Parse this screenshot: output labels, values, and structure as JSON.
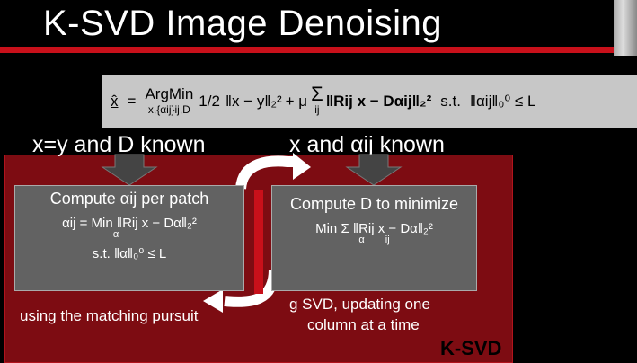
{
  "slide": {
    "title": "K-SVD Image Denoising",
    "formula": {
      "lhs": "x̂",
      "eq": "=",
      "argmin": "ArgMin",
      "argmin_sub": "x,{αij}ij,D",
      "half": "1/2",
      "term1": "‖x − y‖₂²",
      "plus_mu": "+ μ",
      "sum_sub": "ij",
      "term2": "‖Rij x − Dαij‖₂²",
      "st": "s.t.",
      "constraint": "‖αij‖₀⁰ ≤ L"
    },
    "left_known": "x=y and D known",
    "right_known": "x and αij known",
    "left_box": {
      "heading": "Compute αij per patch",
      "eq1": "αij = Min ‖Rij x − Dα‖₂²",
      "eq1_sub": "α",
      "eq2": "s.t. ‖α‖₀⁰ ≤ L"
    },
    "right_box": {
      "heading": "Compute D to minimize",
      "eq1": "Min Σ ‖Rij x − Dα‖₂²",
      "eq1_sub_min": "α",
      "eq1_sub_sum": "ij"
    },
    "left_caption": "using the matching pursuit",
    "right_caption_line1": "g SVD, updating one",
    "right_caption_line2": "column at a time",
    "brand": "K-SVD"
  }
}
